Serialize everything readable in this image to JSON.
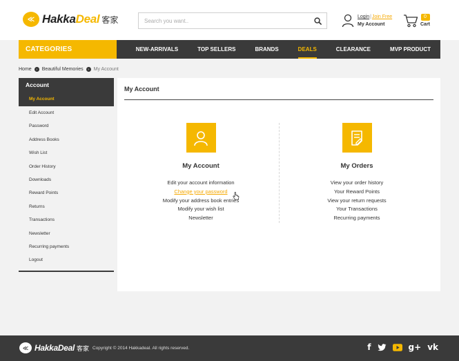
{
  "header": {
    "logo": {
      "brand_first": "Hakka",
      "brand_second": "Deal",
      "brand_cn": "客家"
    },
    "search": {
      "placeholder": "Search you want.."
    },
    "user": {
      "login_label": "Login",
      "separator": "|",
      "join_label": "Join Free",
      "account_label": "My Account"
    },
    "cart": {
      "count": "0",
      "label": "Cart"
    }
  },
  "nav": {
    "categories_label": "CATEGORIES",
    "items": [
      {
        "label": "NEW-ARRIVALS"
      },
      {
        "label": "TOP SELLERS"
      },
      {
        "label": "BRANDS"
      },
      {
        "label": "DEALS",
        "active": true
      },
      {
        "label": "CLEARANCE"
      },
      {
        "label": "MVP PRODUCT"
      }
    ]
  },
  "breadcrumb": [
    {
      "label": "Home"
    },
    {
      "label": "Beautiful Memories"
    },
    {
      "label": "My Account"
    }
  ],
  "sidebar": {
    "title": "Account",
    "items": [
      {
        "label": "My Account",
        "active": true
      },
      {
        "label": "Edit Account"
      },
      {
        "label": "Password"
      },
      {
        "label": "Address Books"
      },
      {
        "label": "Wish List"
      },
      {
        "label": "Order History"
      },
      {
        "label": "Downloads"
      },
      {
        "label": "Reward Points"
      },
      {
        "label": "Returns"
      },
      {
        "label": "Transactions"
      },
      {
        "label": "Newsletter"
      },
      {
        "label": "Recurring payments"
      },
      {
        "label": "Logout"
      }
    ]
  },
  "main": {
    "title": "My Account",
    "account_section": {
      "title": "My Account",
      "links": [
        "Edit your account information",
        "Change your password",
        "Modify your address book entries",
        "Modify your wish list",
        "Newsletter"
      ]
    },
    "orders_section": {
      "title": "My Orders",
      "links": [
        "View your order history",
        "Your Reward Points",
        "View your return requests",
        "Your Transactions",
        "Recurring payments"
      ]
    }
  },
  "footer": {
    "brand_first": "Hakka",
    "brand_second": "Deal",
    "brand_cn": "客家",
    "copyright": "Copyright © 2014 Hakkadeal. All rights reserved.",
    "social": [
      {
        "name": "facebook-icon",
        "glyph": "f"
      },
      {
        "name": "twitter-icon",
        "glyph": "t"
      },
      {
        "name": "youtube-icon",
        "glyph": "▶"
      },
      {
        "name": "google-plus-icon",
        "glyph": "g+"
      },
      {
        "name": "vk-icon",
        "glyph": "vk"
      }
    ]
  },
  "colors": {
    "accent": "#f5b800",
    "dark": "#3a3a3a",
    "background": "#f2f2f2"
  }
}
